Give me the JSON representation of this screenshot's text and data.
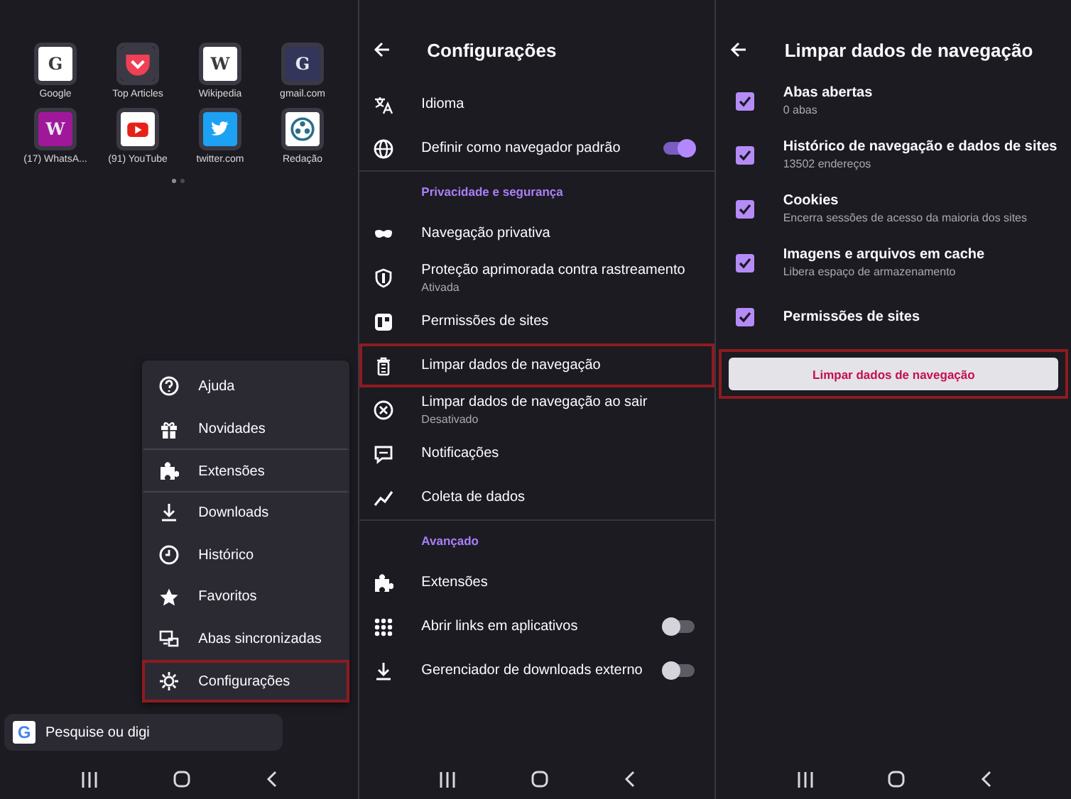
{
  "home": {
    "top_sites": [
      {
        "label": "Google",
        "kind": "letter",
        "letter": "G",
        "color": "#ffffff"
      },
      {
        "label": "Top Articles",
        "kind": "pocket"
      },
      {
        "label": "Wikipedia",
        "kind": "letter",
        "letter": "W",
        "color": "#ffffff"
      },
      {
        "label": "gmail.com",
        "kind": "letter",
        "letter": "G",
        "color": "#33365a"
      },
      {
        "label": "(17) WhatsA...",
        "kind": "letter",
        "letter": "W",
        "color": "#a0189a"
      },
      {
        "label": "(91) YouTube",
        "kind": "youtube"
      },
      {
        "label": "twitter.com",
        "kind": "twitter"
      },
      {
        "label": "Redação",
        "kind": "redacao"
      }
    ],
    "page_dots": [
      {
        "selected": true
      },
      {
        "selected": false
      }
    ],
    "search": {
      "letter": "G",
      "placeholder": "Pesquise ou digi"
    },
    "menu": [
      {
        "label": "Ajuda",
        "highlighted": false,
        "divider_after": false
      },
      {
        "label": "Novidades",
        "highlighted": false,
        "divider_after": true
      },
      {
        "label": "Extensões",
        "highlighted": false,
        "divider_after": true
      },
      {
        "label": "Downloads",
        "highlighted": false,
        "divider_after": false
      },
      {
        "label": "Histórico",
        "highlighted": false,
        "divider_after": false
      },
      {
        "label": "Favoritos",
        "highlighted": false,
        "divider_after": false
      },
      {
        "label": "Abas sincronizadas",
        "highlighted": false,
        "divider_after": false
      },
      {
        "label": "Configurações",
        "highlighted": true,
        "divider_after": false
      }
    ]
  },
  "settings": {
    "title": "Configurações",
    "items": [
      {
        "kind": "item",
        "title": "Idioma",
        "highlighted": false
      },
      {
        "kind": "item",
        "title": "Definir como navegador padrão",
        "toggle": {
          "on": true
        },
        "highlighted": false
      },
      {
        "kind": "section",
        "title": "Privacidade e segurança"
      },
      {
        "kind": "item",
        "title": "Navegação privativa",
        "highlighted": false
      },
      {
        "kind": "item",
        "title": "Proteção aprimorada contra rastreamento",
        "subtitle": "Ativada",
        "highlighted": false
      },
      {
        "kind": "item",
        "title": "Permissões de sites",
        "highlighted": false
      },
      {
        "kind": "item",
        "title": "Limpar dados de navegação",
        "highlighted": true
      },
      {
        "kind": "item",
        "title": "Limpar dados de navegação ao sair",
        "subtitle": "Desativado",
        "highlighted": false
      },
      {
        "kind": "item",
        "title": "Notificações",
        "highlighted": false
      },
      {
        "kind": "item",
        "title": "Coleta de dados",
        "highlighted": false
      },
      {
        "kind": "section",
        "title": "Avançado"
      },
      {
        "kind": "item",
        "title": "Extensões",
        "highlighted": false
      },
      {
        "kind": "item",
        "title": "Abrir links em aplicativos",
        "toggle": {
          "on": false
        },
        "highlighted": false
      },
      {
        "kind": "item",
        "title": "Gerenciador de downloads externo",
        "toggle": {
          "on": false
        },
        "highlighted": false
      }
    ]
  },
  "clear_data": {
    "title": "Limpar dados de navegação",
    "options": [
      {
        "title": "Abas abertas",
        "subtitle": "0 abas",
        "checked": true
      },
      {
        "title": "Histórico de navegação e dados de sites",
        "subtitle": "13502 endereços",
        "checked": true
      },
      {
        "title": "Cookies",
        "subtitle": "Encerra sessões de acesso da maioria dos sites",
        "checked": true
      },
      {
        "title": "Imagens e arquivos em cache",
        "subtitle": "Libera espaço de armazenamento",
        "checked": true
      },
      {
        "title": "Permissões de sites",
        "checked": true
      }
    ],
    "button": {
      "label": "Limpar dados de navegação",
      "highlighted": true
    }
  }
}
